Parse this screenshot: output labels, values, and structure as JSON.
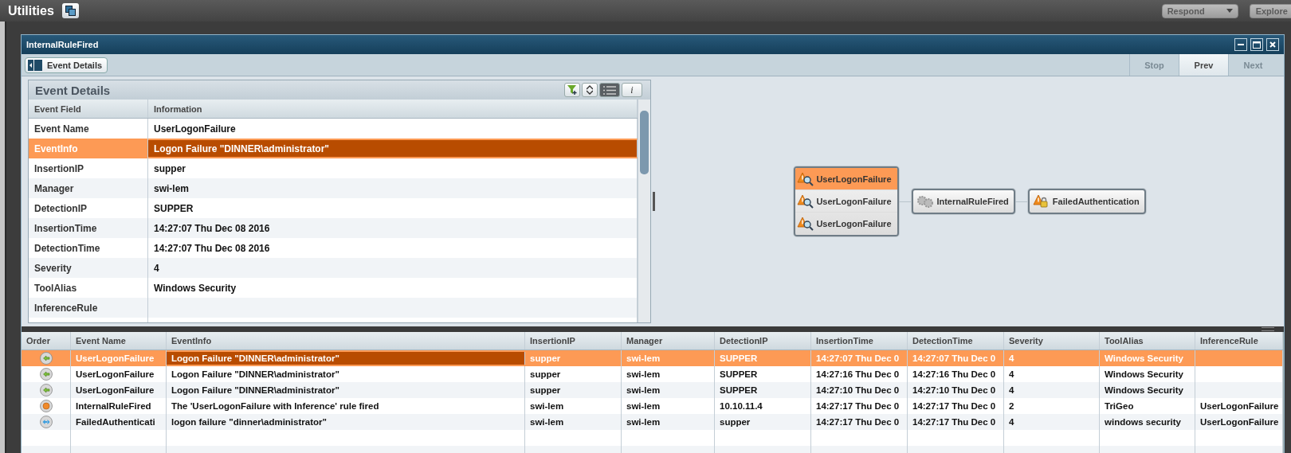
{
  "header": {
    "title": "Utilities",
    "respond": "Respond",
    "explore": "Explore"
  },
  "window": {
    "title": "InternalRuleFired"
  },
  "toolbar": {
    "panel_button": "Event Details",
    "nav": [
      {
        "label": "Stop",
        "selected": false
      },
      {
        "label": "Prev",
        "selected": true
      },
      {
        "label": "Next",
        "selected": false
      }
    ]
  },
  "details": {
    "title": "Event Details",
    "views": [
      {
        "kind": "list",
        "selected": true
      },
      {
        "kind": "info",
        "label": "i",
        "selected": false
      }
    ],
    "columns": [
      "Event Field",
      "Information"
    ],
    "rows": [
      {
        "field": "Event Name",
        "value": "UserLogonFailure",
        "selected": false
      },
      {
        "field": "EventInfo",
        "value": "Logon Failure \"DINNER\\administrator\"",
        "selected": true
      },
      {
        "field": "InsertionIP",
        "value": "supper",
        "selected": false
      },
      {
        "field": "Manager",
        "value": "swi-lem",
        "selected": false
      },
      {
        "field": "DetectionIP",
        "value": "SUPPER",
        "selected": false
      },
      {
        "field": "InsertionTime",
        "value": "14:27:07 Thu Dec 08 2016",
        "selected": false
      },
      {
        "field": "DetectionTime",
        "value": "14:27:07 Thu Dec 08 2016",
        "selected": false
      },
      {
        "field": "Severity",
        "value": "4",
        "selected": false
      },
      {
        "field": "ToolAlias",
        "value": "Windows Security",
        "selected": false
      },
      {
        "field": "InferenceRule",
        "value": "",
        "selected": false
      }
    ]
  },
  "diagram": {
    "group": [
      {
        "label": "UserLogonFailure",
        "selected": true
      },
      {
        "label": "UserLogonFailure",
        "selected": false
      },
      {
        "label": "UserLogonFailure",
        "selected": false
      }
    ],
    "nodes": [
      {
        "label": "InternalRuleFired",
        "kind": "rule"
      },
      {
        "label": "FailedAuthentication",
        "kind": "alert"
      }
    ]
  },
  "table": {
    "columns": [
      "Order",
      "Event Name",
      "EventInfo",
      "InsertionIP",
      "Manager",
      "DetectionIP",
      "InsertionTime",
      "DetectionTime",
      "Severity",
      "ToolAlias",
      "InferenceRule"
    ],
    "rows": [
      {
        "kind": "incoming",
        "selected": true,
        "cells": [
          "",
          "UserLogonFailure",
          "Logon Failure \"DINNER\\administrator\"",
          "supper",
          "swi-lem",
          "SUPPER",
          "14:27:07 Thu Dec 0",
          "14:27:07 Thu Dec 0",
          "4",
          "Windows Security",
          ""
        ]
      },
      {
        "kind": "incoming",
        "selected": false,
        "cells": [
          "",
          "UserLogonFailure",
          "Logon Failure \"DINNER\\administrator\"",
          "supper",
          "swi-lem",
          "SUPPER",
          "14:27:16 Thu Dec 0",
          "14:27:16 Thu Dec 0",
          "4",
          "Windows Security",
          ""
        ]
      },
      {
        "kind": "incoming",
        "selected": false,
        "cells": [
          "",
          "UserLogonFailure",
          "Logon Failure \"DINNER\\administrator\"",
          "supper",
          "swi-lem",
          "SUPPER",
          "14:27:10 Thu Dec 0",
          "14:27:10 Thu Dec 0",
          "4",
          "Windows Security",
          ""
        ]
      },
      {
        "kind": "rule",
        "selected": false,
        "cells": [
          "",
          "InternalRuleFired",
          "The 'UserLogonFailure with Inference' rule fired",
          "swi-lem",
          "swi-lem",
          "10.10.11.4",
          "14:27:17 Thu Dec 0",
          "14:27:17 Thu Dec 0",
          "2",
          "TriGeo",
          "UserLogonFailure"
        ]
      },
      {
        "kind": "outgoing",
        "selected": false,
        "cells": [
          "",
          "FailedAuthenticati",
          "logon failure \"dinner\\administrator\"",
          "swi-lem",
          "swi-lem",
          "supper",
          "14:27:17 Thu Dec 0",
          "14:27:17 Thu Dec 0",
          "4",
          "windows security",
          "UserLogonFailure"
        ]
      }
    ]
  }
}
